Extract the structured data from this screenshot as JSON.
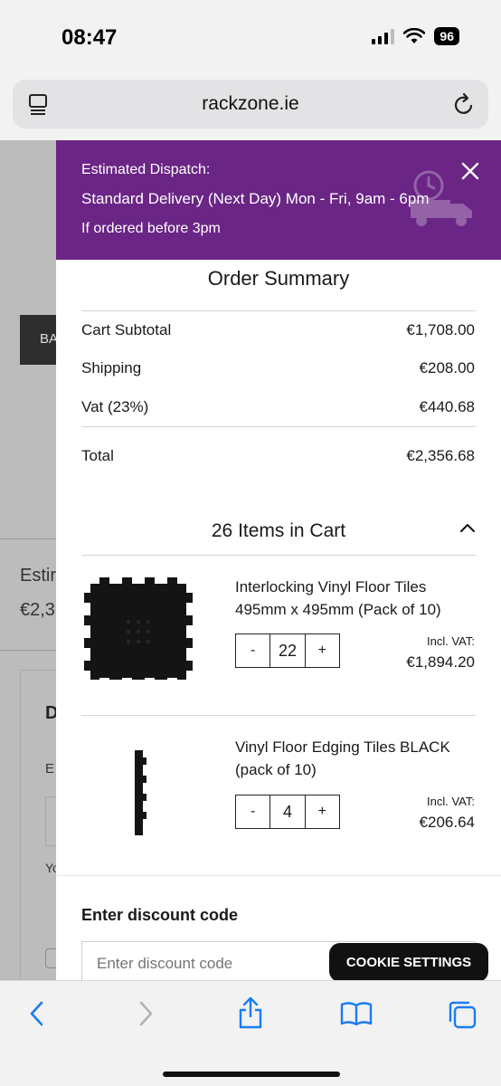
{
  "status_bar": {
    "time": "08:47",
    "battery": "96"
  },
  "browser": {
    "url": "rackzone.ie"
  },
  "background_page": {
    "button_text": "BA",
    "estimate_label": "Estir",
    "estimate_value": "€2,3",
    "section_heading": "D",
    "field_label": "E",
    "field_hint": "Yo"
  },
  "dispatch_banner": {
    "line1": "Estimated Dispatch:",
    "line2": "Standard Delivery (Next Day) Mon - Fri, 9am - 6pm",
    "line3": "If ordered before 3pm"
  },
  "order_summary": {
    "title": "Order Summary",
    "rows": [
      {
        "label": "Cart Subtotal",
        "value": "€1,708.00"
      },
      {
        "label": "Shipping",
        "value": "€208.00"
      },
      {
        "label": "Vat (23%)",
        "value": "€440.68"
      }
    ],
    "total": {
      "label": "Total",
      "value": "€2,356.68"
    }
  },
  "cart": {
    "items_title": "26 Items in Cart",
    "items": [
      {
        "name": "Interlocking Vinyl Floor Tiles 495mm x 495mm (Pack of 10)",
        "qty": "22",
        "minus": "-",
        "plus": "+",
        "incl_vat": "Incl. VAT:",
        "price": "€1,894.20"
      },
      {
        "name": "Vinyl Floor Edging Tiles BLACK (pack of 10)",
        "qty": "4",
        "minus": "-",
        "plus": "+",
        "incl_vat": "Incl. VAT:",
        "price": "€206.64"
      }
    ]
  },
  "discount": {
    "label": "Enter discount code",
    "placeholder": "Enter discount code"
  },
  "cookie_button": "COOKIE SETTINGS",
  "colors": {
    "banner": "#6a2585",
    "ios_blue": "#1a7cf5"
  }
}
